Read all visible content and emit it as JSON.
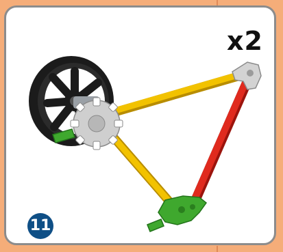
{
  "step": {
    "number": "11",
    "multiplier": "x2"
  },
  "colors": {
    "background": "#f5ad79",
    "panel": "#ffffff",
    "panel_border": "#8c8c8c",
    "badge": "#0f4f86",
    "yellow_rod": "#f2c200",
    "red_rod": "#e02a1e",
    "green_connector": "#3fa82e",
    "grey_connector": "#c9c9c9",
    "wheel": "#1b1b1b"
  },
  "parts": {
    "wheel": "wheel-icon",
    "connectors": [
      "grey-hub-connector",
      "grey-corner-connector",
      "green-corner-connector"
    ],
    "rods": [
      "yellow-rod",
      "yellow-rod",
      "red-rod"
    ]
  }
}
